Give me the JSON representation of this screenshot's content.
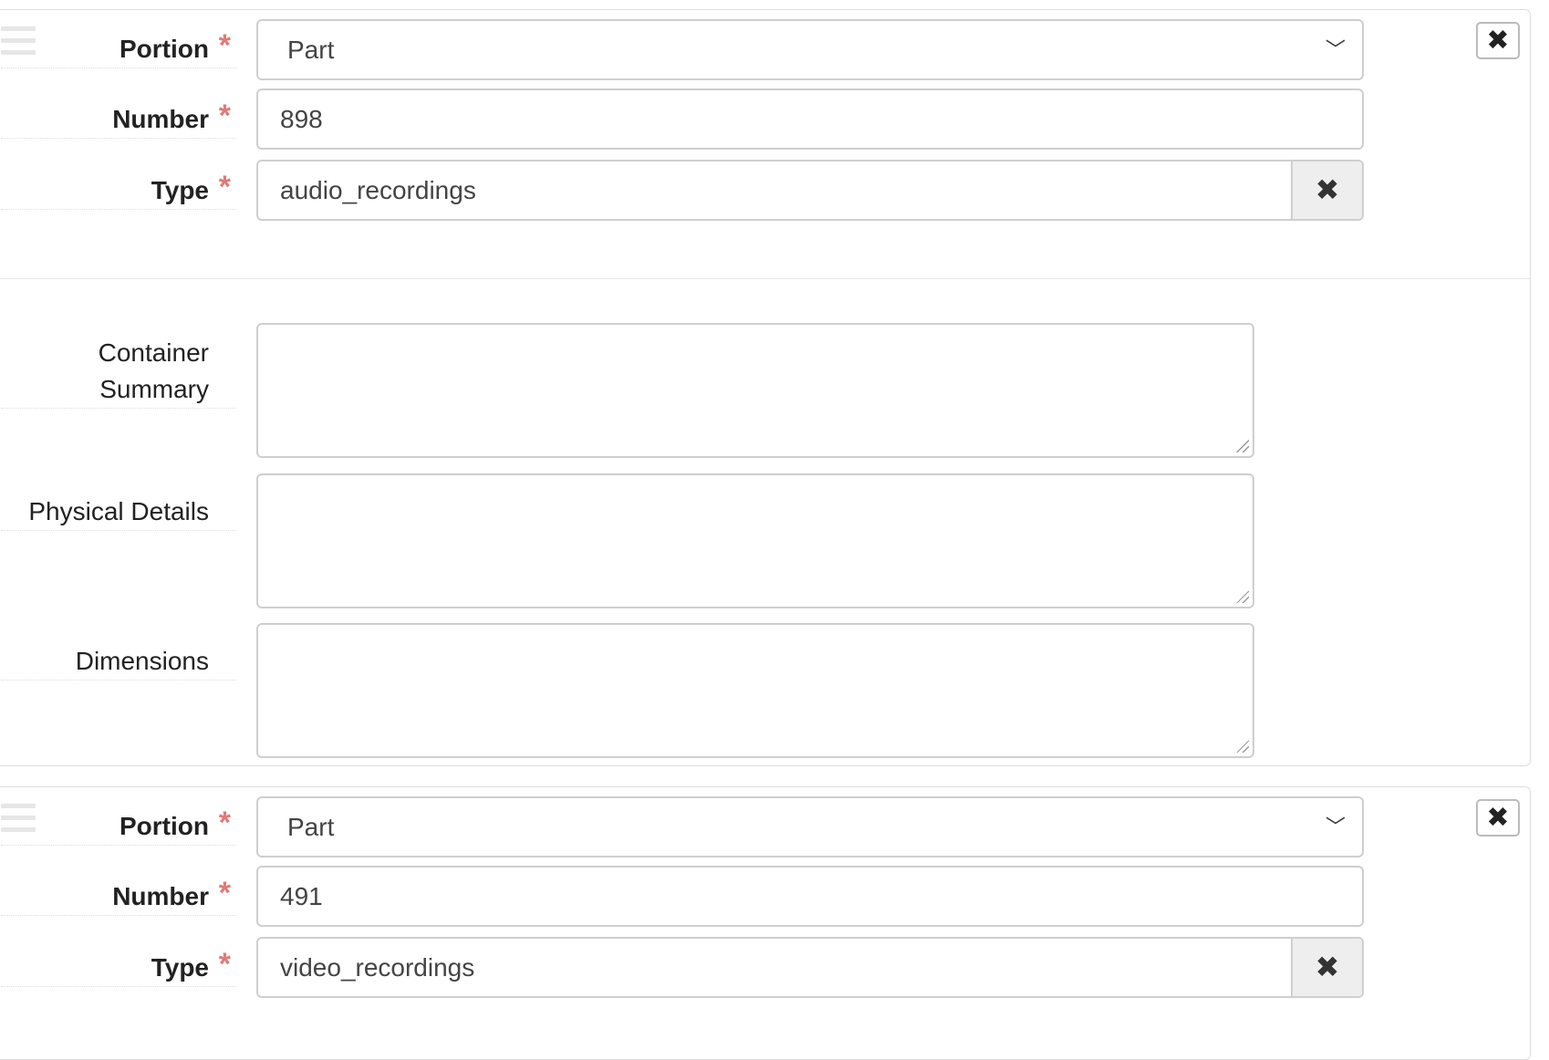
{
  "remove_icon": "close-icon",
  "required_color": "#e07a77",
  "instances": [
    {
      "portion": {
        "label": "Portion",
        "value": "Part"
      },
      "number": {
        "label": "Number",
        "value": "898"
      },
      "type": {
        "label": "Type",
        "value": "audio_recordings"
      },
      "container_summary": {
        "label_line1": "Container",
        "label_line2": "Summary",
        "value": ""
      },
      "physical_details": {
        "label": "Physical Details",
        "value": ""
      },
      "dimensions": {
        "label": "Dimensions",
        "value": ""
      }
    },
    {
      "portion": {
        "label": "Portion",
        "value": "Part"
      },
      "number": {
        "label": "Number",
        "value": "491"
      },
      "type": {
        "label": "Type",
        "value": "video_recordings"
      }
    }
  ]
}
